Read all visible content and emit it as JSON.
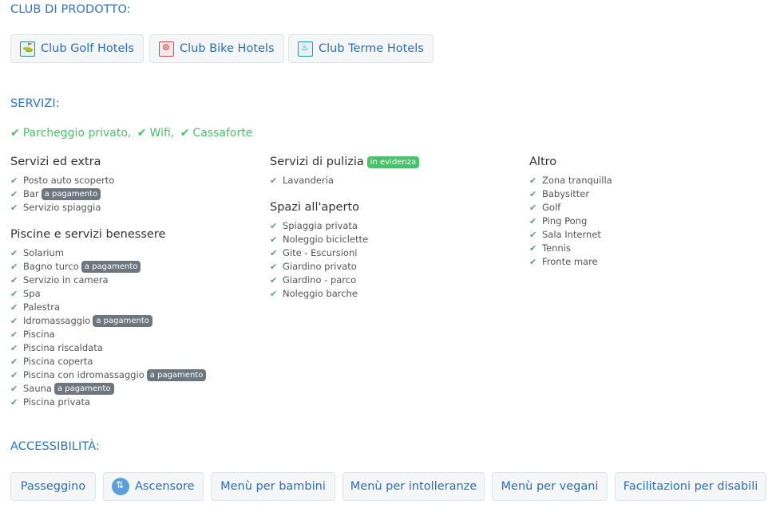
{
  "club": {
    "title": "CLUB DI PRODOTTO:",
    "buttons": [
      {
        "label": "Club Golf Hotels",
        "icon": "golf-icon"
      },
      {
        "label": "Club Bike Hotels",
        "icon": "bike-icon"
      },
      {
        "label": "Club Terme Hotels",
        "icon": "terme-icon"
      }
    ]
  },
  "servizi": {
    "title": "SERVIZI:",
    "top": [
      "Parcheggio privato,",
      "Wifi,",
      "Cassaforte"
    ],
    "col1": {
      "g1": {
        "title": "Servizi ed extra",
        "items": [
          "Posto auto scoperto",
          "Bar",
          "Servizio spiaggia"
        ]
      },
      "g2": {
        "title": "Piscine e servizi benessere",
        "items": [
          "Solarium",
          "Bagno turco",
          "Servizio in camera",
          "Spa",
          "Palestra",
          "Idromassaggio",
          "Piscina",
          "Piscina riscaldata",
          "Piscina coperta",
          "Piscina con idromassaggio",
          "Sauna",
          "Piscina privata"
        ]
      }
    },
    "col2": {
      "g1": {
        "title": "Servizi di pulizia",
        "badge": "in evidenza",
        "items": [
          "Lavanderia"
        ]
      },
      "g2": {
        "title": "Spazi all'aperto",
        "items": [
          "Spiaggia privata",
          "Noleggio biciclette",
          "Gite - Escursioni",
          "Giardino privato",
          "Giardino - parco",
          "Noleggio barche"
        ]
      }
    },
    "col3": {
      "g1": {
        "title": "Altro",
        "items": [
          "Zona tranquilla",
          "Babysitter",
          "Golf",
          "Ping Pong",
          "Sala Internet",
          "Tennis",
          "Fronte mare"
        ]
      }
    },
    "paid_badge": "a pagamento"
  },
  "accessibilita": {
    "title": "ACCESSIBILITÀ:",
    "buttons": [
      "Passeggino",
      "Ascensore",
      "Menù per bambini",
      "Menù per intolleranze",
      "Menù per vegani",
      "Facilitazioni per disabili"
    ]
  },
  "colors": {
    "accent": "#2a74c9",
    "check": "#4cc06a",
    "badge": "#6e7780"
  }
}
